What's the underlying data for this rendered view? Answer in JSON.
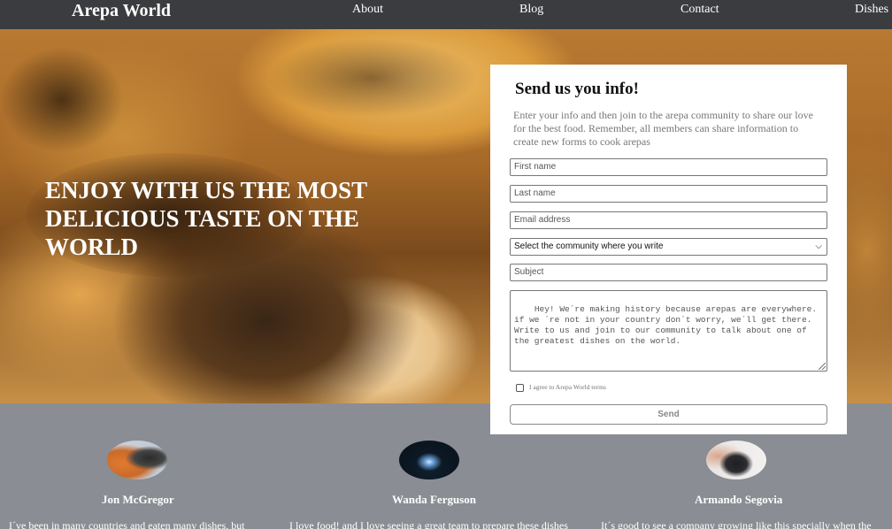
{
  "nav": {
    "brand": "Arepa World",
    "links": [
      "About",
      "Blog",
      "Contact",
      "Dishes"
    ]
  },
  "hero": {
    "title": "ENJOY WITH US THE MOST DELICIOUS TASTE ON THE WORLD"
  },
  "form": {
    "heading": "Send us you info!",
    "intro": "Enter your info and then join to the arepa community to share our love for the best food. Remember, all members can share information to create new forms to cook arepas",
    "first_name_placeholder": "First name",
    "last_name_placeholder": "Last name",
    "email_placeholder": "Email address",
    "community_selected": "Select the community where you write",
    "subject_placeholder": "Subject",
    "message_placeholder": "Hey! We´re making history because arepas are everywhere. if we ´re not in your country don´t worry, we´ll get there. Write to us and join to our community to talk about one of the greatest dishes on the world.",
    "agree_label": "I agree to Arepa World terms",
    "agree_checked": false,
    "send_label": "Send"
  },
  "testimonials": [
    {
      "name": "Jon McGregor",
      "quote": "I´ve been in many countries and eaten many dishes, but"
    },
    {
      "name": "Wanda Ferguson",
      "quote": "I love food! and I love seeing a great team to prepare these dishes"
    },
    {
      "name": "Armando Segovia",
      "quote": "It´s good to see a company growing like this specially when the"
    }
  ],
  "colors": {
    "nav_bg": "#3b3c3f",
    "section_bg": "#8a8d93",
    "card_bg": "#ffffff"
  }
}
